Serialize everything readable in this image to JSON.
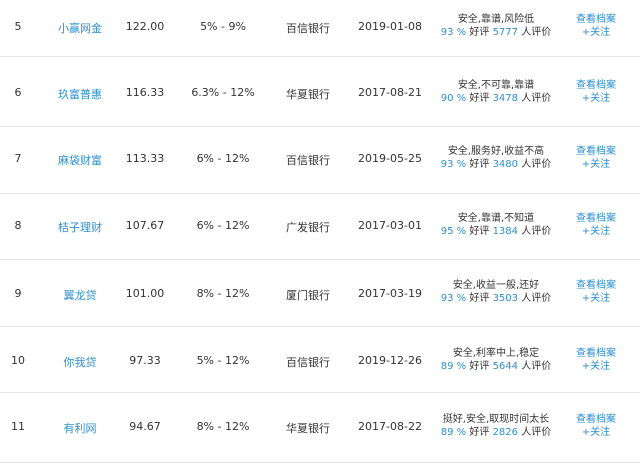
{
  "colors": {
    "link": "#2f8fd0",
    "text": "#333333",
    "divider": "#e6e6e6"
  },
  "rows": [
    {
      "rank": "5",
      "name": "小赢网金",
      "score": "122.00",
      "rate": "5% - 9%",
      "bank": "百信银行",
      "date": "2019-01-08",
      "tags": "安全,靠谱,风险低",
      "pct": "93 %",
      "good_label": "好评",
      "count": "5777",
      "count_suffix": "人评价",
      "view_label": "查看档案",
      "follow_label": "+关注"
    },
    {
      "rank": "6",
      "name": "玖富普惠",
      "score": "116.33",
      "rate": "6.3% - 12%",
      "bank": "华夏银行",
      "date": "2017-08-21",
      "tags": "安全,不可靠,靠谱",
      "pct": "90 %",
      "good_label": "好评",
      "count": "3478",
      "count_suffix": "人评价",
      "view_label": "查看档案",
      "follow_label": "+关注"
    },
    {
      "rank": "7",
      "name": "麻袋财富",
      "score": "113.33",
      "rate": "6% - 12%",
      "bank": "百信银行",
      "date": "2019-05-25",
      "tags": "安全,服务好,收益不高",
      "pct": "93 %",
      "good_label": "好评",
      "count": "3480",
      "count_suffix": "人评价",
      "view_label": "查看档案",
      "follow_label": "+关注"
    },
    {
      "rank": "8",
      "name": "桔子理财",
      "score": "107.67",
      "rate": "6% - 12%",
      "bank": "广发银行",
      "date": "2017-03-01",
      "tags": "安全,靠谱,不知道",
      "pct": "95 %",
      "good_label": "好评",
      "count": "1384",
      "count_suffix": "人评价",
      "view_label": "查看档案",
      "follow_label": "+关注"
    },
    {
      "rank": "9",
      "name": "翼龙贷",
      "score": "101.00",
      "rate": "8% - 12%",
      "bank": "厦门银行",
      "date": "2017-03-19",
      "tags": "安全,收益一般,还好",
      "pct": "93 %",
      "good_label": "好评",
      "count": "3503",
      "count_suffix": "人评价",
      "view_label": "查看档案",
      "follow_label": "+关注"
    },
    {
      "rank": "10",
      "name": "你我贷",
      "score": "97.33",
      "rate": "5% - 12%",
      "bank": "百信银行",
      "date": "2019-12-26",
      "tags": "安全,利率中上,稳定",
      "pct": "89 %",
      "good_label": "好评",
      "count": "5644",
      "count_suffix": "人评价",
      "view_label": "查看档案",
      "follow_label": "+关注"
    },
    {
      "rank": "11",
      "name": "有利网",
      "score": "94.67",
      "rate": "8% - 12%",
      "bank": "华夏银行",
      "date": "2017-08-22",
      "tags": "挺好,安全,取现时间太长",
      "pct": "89 %",
      "good_label": "好评",
      "count": "2826",
      "count_suffix": "人评价",
      "view_label": "查看档案",
      "follow_label": "+关注"
    }
  ]
}
